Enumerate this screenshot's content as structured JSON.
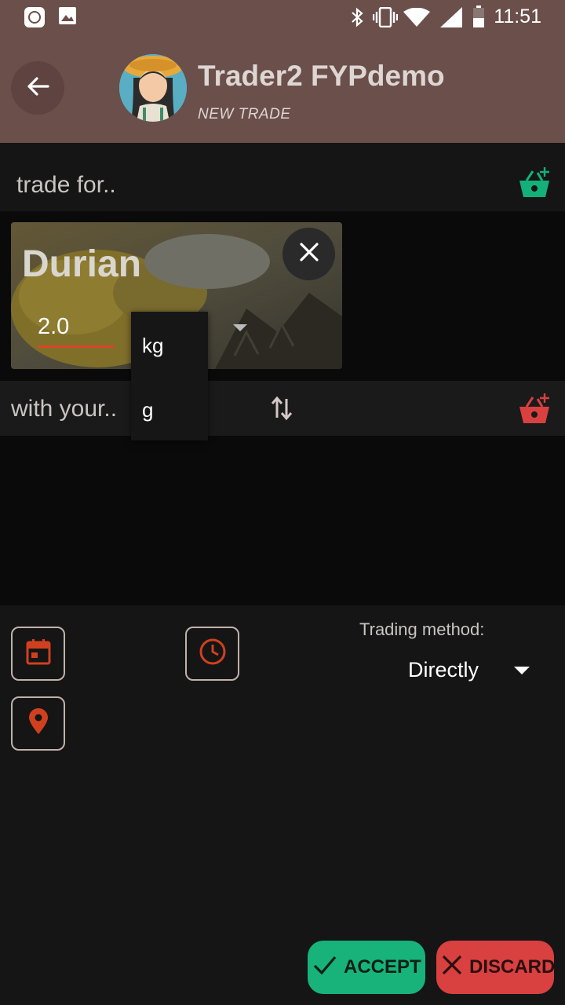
{
  "status_bar": {
    "time": "11:51",
    "icons": [
      "notification-icon",
      "image-icon",
      "bluetooth-icon",
      "vibrate-icon",
      "wifi-icon",
      "signal-icon",
      "battery-icon"
    ]
  },
  "header": {
    "title": "Trader2 FYPdemo",
    "subtitle": "NEW TRADE"
  },
  "trade_for": {
    "label": "trade for..",
    "basket_icon_color": "#13b07a"
  },
  "item_card": {
    "name": "Durian",
    "quantity": "2.0",
    "unit_options": [
      "kg",
      "g"
    ]
  },
  "with_your": {
    "label": "with your..",
    "basket_icon_color": "#d94040"
  },
  "trading_method": {
    "label": "Trading method:",
    "value": "Directly"
  },
  "buttons": {
    "accept": "ACCEPT",
    "discard": "DISCARD"
  },
  "colors": {
    "header_bg": "#6b4f4b",
    "accent_red": "#d0401f",
    "accept_green": "#17b37a",
    "discard_red": "#d94040"
  }
}
